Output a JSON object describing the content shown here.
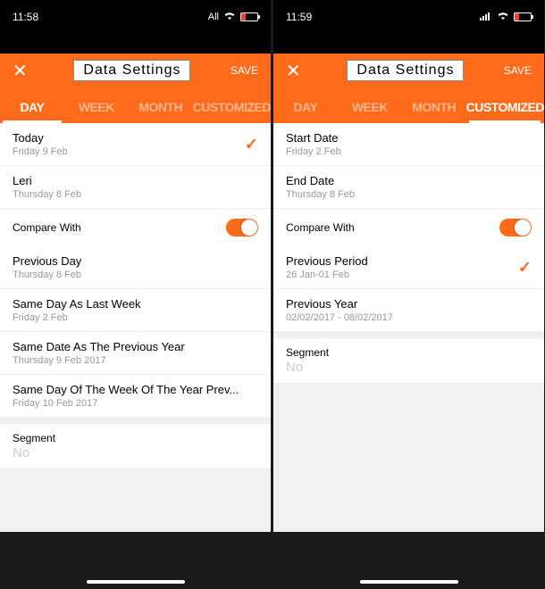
{
  "left": {
    "status": {
      "time": "11:58",
      "carrier": "All",
      "battery_low": true
    },
    "header": {
      "title": "Data Settings",
      "save": "SAVE"
    },
    "tabs": [
      "DAY",
      "WEEK",
      "MONTH",
      "CUSTOMIZED"
    ],
    "active_tab": 0,
    "options": [
      {
        "title": "Today",
        "sub": "Friday 9 Feb",
        "selected": true
      },
      {
        "title": "Leri",
        "sub": "Thursday 8 Feb",
        "selected": false
      }
    ],
    "compare_label": "Compare With",
    "compare_on": true,
    "compare_options": [
      {
        "title": "Previous Day",
        "sub": "Thursday 8 Feb"
      },
      {
        "title": "Same Day As Last Week",
        "sub": "Friday 2 Feb"
      },
      {
        "title": "Same Date As The Previous Year",
        "sub": "Thursday 9 Feb 2017"
      },
      {
        "title": "Same Day Of The Week Of The Year Prev...",
        "sub": "Friday 10 Feb 2017"
      }
    ],
    "segment": {
      "label": "Segment",
      "value": "No"
    }
  },
  "right": {
    "status": {
      "time": "11:59",
      "carrier": "",
      "battery_low": true
    },
    "header": {
      "title": "Data Settings",
      "save": "SAVE"
    },
    "tabs": [
      "DAY",
      "WEEK",
      "MONTH",
      "CUSTOMIZED"
    ],
    "active_tab": 3,
    "dates": [
      {
        "title": "Start Date",
        "sub": "Friday 2 Feb"
      },
      {
        "title": "End Date",
        "sub": "Thursday 8 Feb"
      }
    ],
    "compare_label": "Compare With",
    "compare_on": true,
    "compare_options": [
      {
        "title": "Previous Period",
        "sub": "26 Jan-01 Feb",
        "selected": true
      },
      {
        "title": "Previous Year",
        "sub": "02/02/2017 - 08/02/2017",
        "selected": false
      }
    ],
    "segment": {
      "label": "Segment",
      "value": "No"
    }
  }
}
